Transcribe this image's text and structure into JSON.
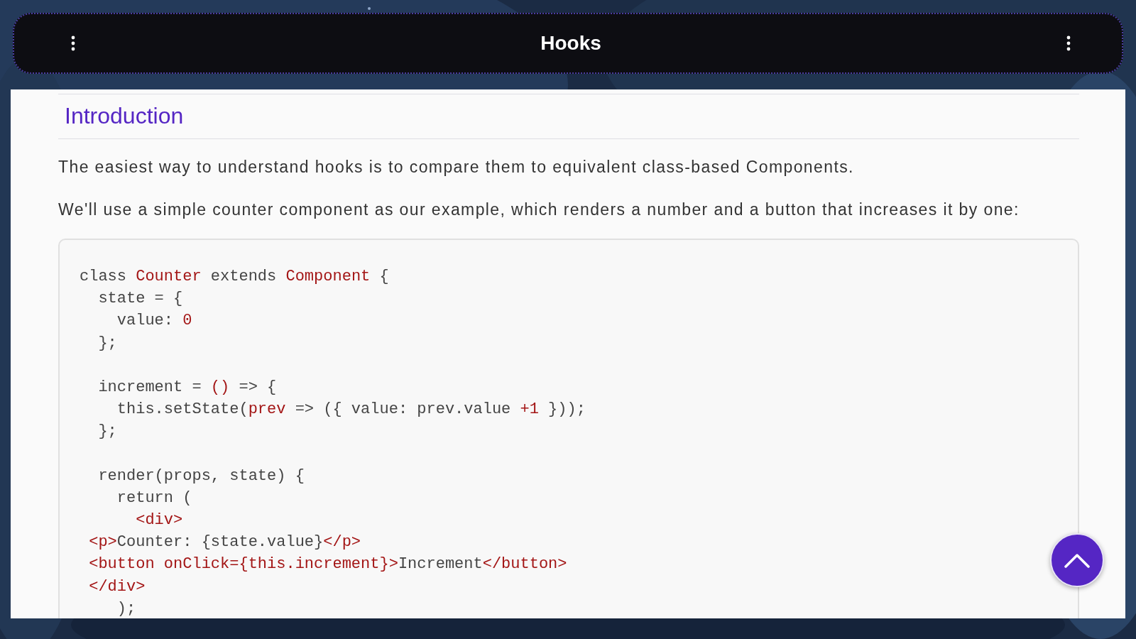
{
  "header": {
    "title": "Hooks"
  },
  "section": {
    "heading": "Introduction",
    "paragraphs": [
      "The easiest way to understand hooks is to compare them to equivalent class-based Components.",
      "We'll use a simple counter component as our example, which renders a number and a button that increases it by one:"
    ],
    "code": [
      {
        "kind": "code",
        "tokens": [
          {
            "text": "class ",
            "kind": "plain"
          },
          {
            "text": "Counter",
            "kind": "accent"
          },
          {
            "text": " extends ",
            "kind": "plain"
          },
          {
            "text": "Component",
            "kind": "accent"
          },
          {
            "text": " {",
            "kind": "plain"
          }
        ]
      },
      {
        "kind": "code",
        "tokens": [
          {
            "text": "  state = {",
            "kind": "plain"
          }
        ]
      },
      {
        "kind": "code",
        "tokens": [
          {
            "text": "    value: ",
            "kind": "plain"
          },
          {
            "text": "0",
            "kind": "accent"
          }
        ]
      },
      {
        "kind": "code",
        "tokens": [
          {
            "text": "  };",
            "kind": "plain"
          }
        ]
      },
      {
        "kind": "blank"
      },
      {
        "kind": "code",
        "tokens": [
          {
            "text": "  increment = ",
            "kind": "plain"
          },
          {
            "text": "()",
            "kind": "accent"
          },
          {
            "text": " => {",
            "kind": "plain"
          }
        ]
      },
      {
        "kind": "code",
        "tokens": [
          {
            "text": "    this.setState(",
            "kind": "plain"
          },
          {
            "text": "prev",
            "kind": "accent"
          },
          {
            "text": " => ({ value: prev.value ",
            "kind": "plain"
          },
          {
            "text": "+1",
            "kind": "accent"
          },
          {
            "text": " }));",
            "kind": "plain"
          }
        ]
      },
      {
        "kind": "code",
        "tokens": [
          {
            "text": "  };",
            "kind": "plain"
          }
        ]
      },
      {
        "kind": "blank"
      },
      {
        "kind": "code",
        "tokens": [
          {
            "text": "  render(props, state) {",
            "kind": "plain"
          }
        ]
      },
      {
        "kind": "code",
        "tokens": [
          {
            "text": "    return (",
            "kind": "plain"
          }
        ]
      },
      {
        "kind": "code",
        "tokens": [
          {
            "text": "      <div>",
            "kind": "accent"
          }
        ]
      },
      {
        "kind": "code",
        "tokens": [
          {
            "text": " <p>",
            "kind": "accent"
          },
          {
            "text": "Counter: {state.value}",
            "kind": "plain"
          },
          {
            "text": "</p>",
            "kind": "accent"
          }
        ]
      },
      {
        "kind": "code",
        "tokens": [
          {
            "text": " <button onClick={this.increment}>",
            "kind": "accent"
          },
          {
            "text": "Increment",
            "kind": "plain"
          },
          {
            "text": "</button>",
            "kind": "accent"
          }
        ]
      },
      {
        "kind": "code",
        "tokens": [
          {
            "text": " </div>",
            "kind": "accent"
          }
        ]
      },
      {
        "kind": "code",
        "tokens": [
          {
            "text": "    );",
            "kind": "plain"
          }
        ]
      }
    ]
  }
}
